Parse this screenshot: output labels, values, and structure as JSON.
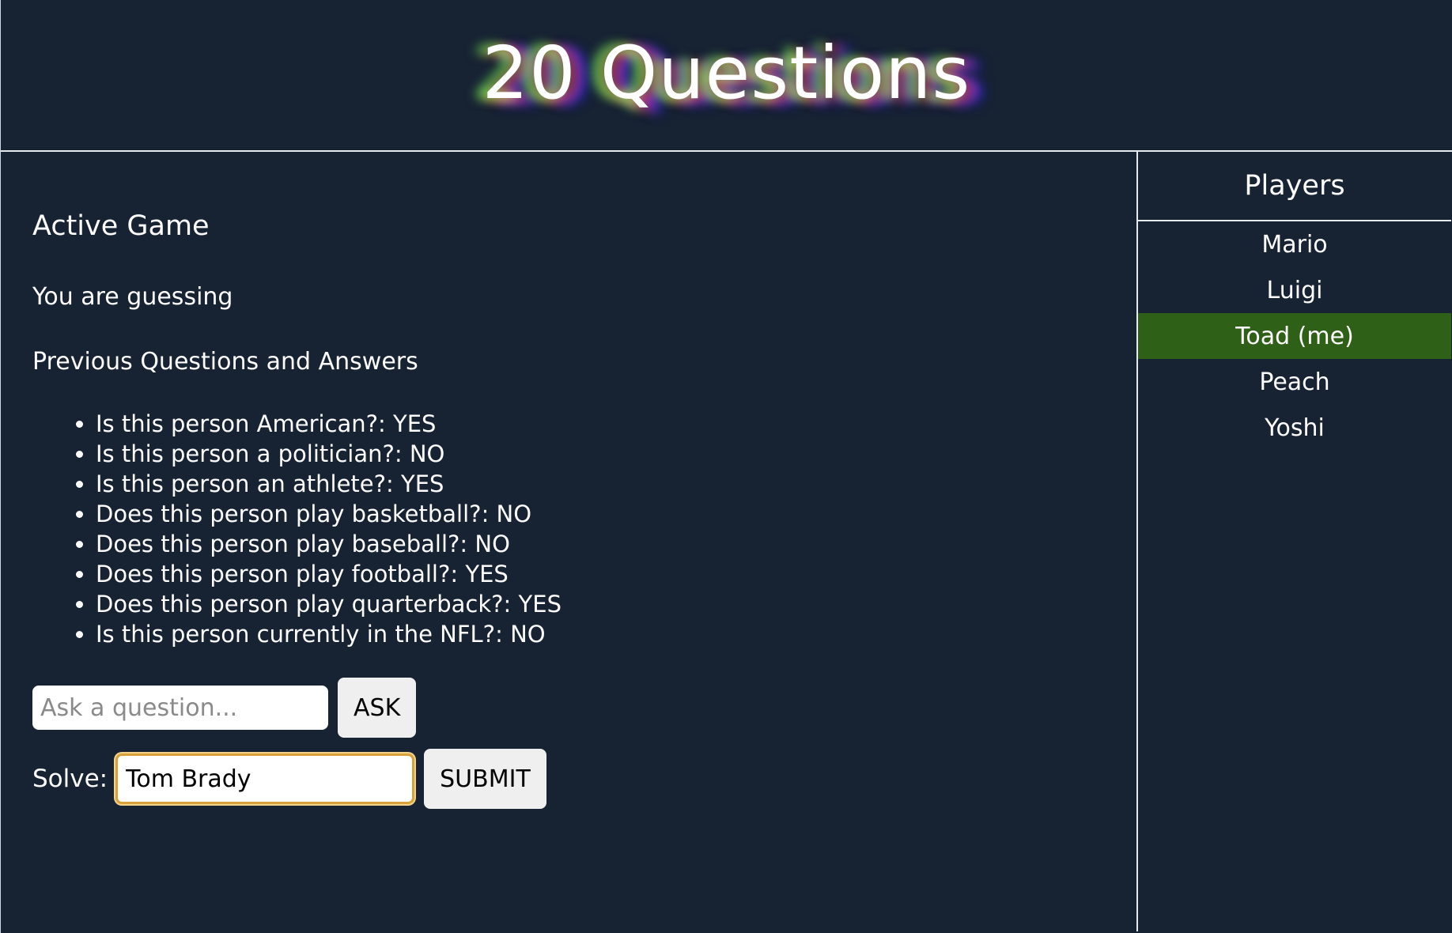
{
  "header": {
    "title": "20 Questions"
  },
  "main": {
    "heading": "Active Game",
    "status": "You are guessing",
    "qa_title": "Previous Questions and Answers",
    "qa_items": [
      "Is this person American?: YES",
      "Is this person a politician?: NO",
      "Is this person an athlete?: YES",
      "Does this person play basketball?: NO",
      "Does this person play baseball?: NO",
      "Does this person play football?: YES",
      "Does this person play quarterback?: YES",
      "Is this person currently in the NFL?: NO"
    ],
    "ask": {
      "placeholder": "Ask a question...",
      "value": "",
      "button_label": "ASK"
    },
    "solve": {
      "label": "Solve:",
      "value": "Tom Brady",
      "button_label": "SUBMIT"
    }
  },
  "sidebar": {
    "title": "Players",
    "players": [
      {
        "name": "Mario",
        "is_me": false
      },
      {
        "name": "Luigi",
        "is_me": false
      },
      {
        "name": "Toad (me)",
        "is_me": true
      },
      {
        "name": "Peach",
        "is_me": false
      },
      {
        "name": "Yoshi",
        "is_me": false
      }
    ],
    "highlight_color": "#2e6117"
  },
  "colors": {
    "background": "#172233",
    "text": "#ffffff",
    "button_bg": "#efefef",
    "focus_border": "#d9a13a"
  }
}
